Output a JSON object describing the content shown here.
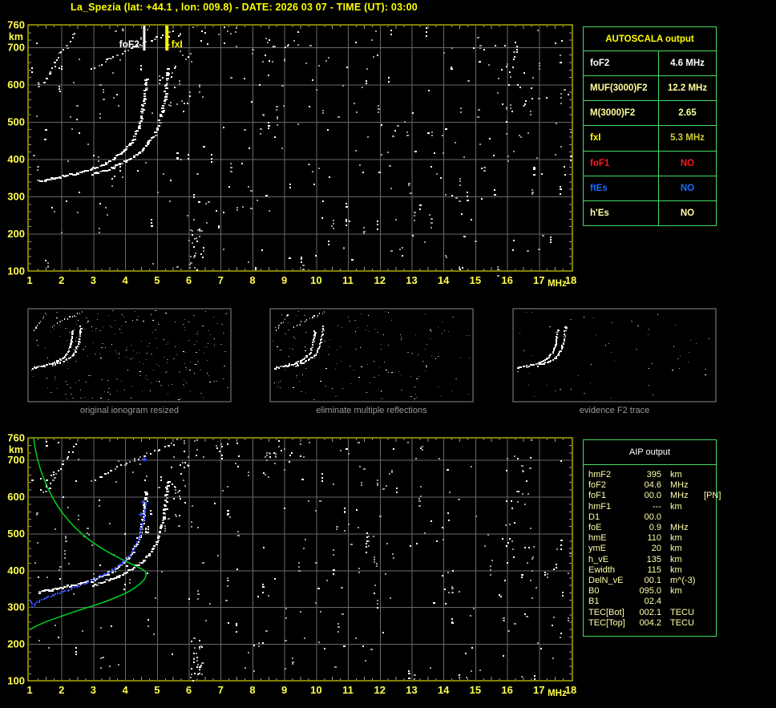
{
  "title": "La_Spezia (lat: +44.1 , lon: 009.8) - DATE: 2026 03 07 - TIME (UT): 03:00",
  "colors": {
    "background": "#000000",
    "plot_border": "#ffff00",
    "grid": "#686868",
    "tick": "#9a9a9a",
    "axis_text": "#ffff4d",
    "title_text": "#ffff00",
    "table_border": "#44dd66",
    "autoscala_title": "#ffff00",
    "panel_border": "#8a8a8a",
    "caption_text": "#9a9a9a",
    "trace_white": "#ffffff",
    "noise_gray": "#9b9b9b",
    "profile_green": "#00dd22",
    "fitted_blue": "#3a50ff",
    "aip_text": "#ffffa8",
    "aip_title": "#ffffff"
  },
  "autoscala_table": {
    "title": "AUTOSCALA output",
    "rows": [
      {
        "label": "foF2",
        "value": "4.6 MHz",
        "label_color": "#ffffff",
        "value_color": "#ffffff"
      },
      {
        "label": "MUF(3000)F2",
        "value": "12.2 MHz",
        "label_color": "#ffff99",
        "value_color": "#ffff99"
      },
      {
        "label": "M(3000)F2",
        "value": "2.65",
        "label_color": "#ffff99",
        "value_color": "#ffff99"
      },
      {
        "label": "fxI",
        "value": "5.3 MHz",
        "label_color": "#ffff00",
        "value_color": "#cdcd2e"
      },
      {
        "label": "foF1",
        "value": "NO",
        "label_color": "#ff1a1a",
        "value_color": "#ff1a1a"
      },
      {
        "label": "ftEs",
        "value": "NO",
        "label_color": "#1a6aff",
        "value_color": "#1a6aff"
      },
      {
        "label": "h'Es",
        "value": "NO",
        "label_color": "#ffffaa",
        "value_color": "#ffffaa"
      }
    ]
  },
  "aip_table": {
    "title": "AIP output",
    "rows": [
      {
        "name": "hmF2",
        "value": "395",
        "unit": "km",
        "extra": ""
      },
      {
        "name": "foF2",
        "value": "04.6",
        "unit": "MHz",
        "extra": ""
      },
      {
        "name": "foF1",
        "value": "00.0",
        "unit": "MHz",
        "extra": "[PN]"
      },
      {
        "name": "hmF1",
        "value": "---",
        "unit": "km",
        "extra": ""
      },
      {
        "name": "D1",
        "value": "00.0",
        "unit": "",
        "extra": ""
      },
      {
        "name": "foE",
        "value": "0.9",
        "unit": "MHz",
        "extra": ""
      },
      {
        "name": "hmE",
        "value": "110",
        "unit": "km",
        "extra": ""
      },
      {
        "name": "ymE",
        "value": "20",
        "unit": "km",
        "extra": ""
      },
      {
        "name": "h_vE",
        "value": "135",
        "unit": "km",
        "extra": ""
      },
      {
        "name": "Ewidth",
        "value": "115",
        "unit": "km",
        "extra": ""
      },
      {
        "name": "DelN_vE",
        "value": "00.1",
        "unit": "m^(-3)",
        "extra": ""
      },
      {
        "name": "B0",
        "value": "095.0",
        "unit": "km",
        "extra": ""
      },
      {
        "name": "B1",
        "value": "02.4",
        "unit": "",
        "extra": ""
      },
      {
        "name": "TEC[Bot]",
        "value": "002.1",
        "unit": "TECU",
        "extra": ""
      },
      {
        "name": "TEC[Top]",
        "value": "004.2",
        "unit": "TECU",
        "extra": ""
      }
    ]
  },
  "panels": [
    {
      "caption": "original ionogram resized",
      "noise_dots": 240,
      "show_multiples": true
    },
    {
      "caption": "eliminate multiple reflections",
      "noise_dots": 150,
      "show_multiples": true
    },
    {
      "caption": "evidence F2 trace",
      "noise_dots": 55,
      "show_multiples": false
    }
  ],
  "chart_data": [
    {
      "id": "top-ionogram",
      "type": "scatter",
      "title": "",
      "xlabel": "MHz",
      "ylabel": "km",
      "xlim": [
        1,
        18
      ],
      "ylim": [
        100,
        760
      ],
      "xticks": [
        1,
        2,
        3,
        4,
        5,
        6,
        7,
        8,
        9,
        10,
        11,
        12,
        13,
        14,
        15,
        16,
        17,
        18
      ],
      "yticks": [
        100,
        200,
        300,
        400,
        500,
        600,
        700,
        760
      ],
      "grid": true,
      "annotations": [
        {
          "label": "foF2",
          "freq": 4.6,
          "color": "#ffffff",
          "side": "left"
        },
        {
          "label": "fxI",
          "freq": 5.3,
          "color": "#ffff00",
          "side": "right"
        }
      ],
      "series": [
        {
          "name": "F2 ordinary echo trace",
          "points": [
            [
              1.25,
              342
            ],
            [
              1.6,
              348
            ],
            [
              2.0,
              355
            ],
            [
              2.4,
              362
            ],
            [
              2.8,
              371
            ],
            [
              3.15,
              382
            ],
            [
              3.45,
              394
            ],
            [
              3.7,
              408
            ],
            [
              3.95,
              425
            ],
            [
              4.15,
              445
            ],
            [
              4.3,
              468
            ],
            [
              4.42,
              495
            ],
            [
              4.5,
              525
            ],
            [
              4.56,
              556
            ],
            [
              4.6,
              590
            ],
            [
              4.63,
              618
            ]
          ]
        },
        {
          "name": "F2 extraordinary echo trace",
          "points": [
            [
              2.95,
              362
            ],
            [
              3.3,
              371
            ],
            [
              3.65,
              382
            ],
            [
              3.95,
              394
            ],
            [
              4.25,
              408
            ],
            [
              4.5,
              424
            ],
            [
              4.7,
              442
            ],
            [
              4.87,
              463
            ],
            [
              5.0,
              489
            ],
            [
              5.1,
              518
            ],
            [
              5.18,
              550
            ],
            [
              5.24,
              582
            ],
            [
              5.28,
              615
            ],
            [
              5.31,
              645
            ]
          ]
        },
        {
          "name": "multiple reflection streak A",
          "points": [
            [
              1.45,
              612
            ],
            [
              1.7,
              648
            ],
            [
              1.95,
              682
            ],
            [
              2.2,
              714
            ],
            [
              2.45,
              744
            ]
          ]
        },
        {
          "name": "multiple reflection streak B",
          "points": [
            [
              2.95,
              643
            ],
            [
              3.45,
              668
            ],
            [
              4.0,
              692
            ],
            [
              4.55,
              714
            ],
            [
              5.1,
              733
            ],
            [
              5.6,
              748
            ]
          ]
        }
      ],
      "noise": {
        "uniform_dots": 300,
        "clusters": [
          {
            "f": [
              6.0,
              6.45
            ],
            "alt": [
              100,
              215
            ],
            "count": 26
          },
          {
            "f": [
              5.35,
              6.05
            ],
            "alt": [
              540,
              700
            ],
            "count": 20
          },
          {
            "f": [
              14.4,
              14.7
            ],
            "alt": [
              100,
              118
            ],
            "count": 4
          },
          {
            "f": [
              15.9,
              16.8
            ],
            "alt": [
              420,
              760
            ],
            "count": 26
          },
          {
            "f": [
              8.3,
              9.6
            ],
            "alt": [
              660,
              760
            ],
            "count": 14
          },
          {
            "f": [
              5.6,
              7.6
            ],
            "alt": [
              700,
              760
            ],
            "count": 16
          }
        ]
      }
    },
    {
      "id": "bottom-ionogram",
      "type": "scatter",
      "title": "",
      "xlabel": "MHz",
      "ylabel": "km",
      "xlim": [
        1,
        18
      ],
      "ylim": [
        100,
        760
      ],
      "xticks": [
        1,
        2,
        3,
        4,
        5,
        6,
        7,
        8,
        9,
        10,
        11,
        12,
        13,
        14,
        15,
        16,
        17,
        18
      ],
      "yticks": [
        100,
        200,
        300,
        400,
        500,
        600,
        700,
        760
      ],
      "grid": true,
      "annotations": [],
      "series": [
        {
          "name": "F2 ordinary echo trace",
          "points": [
            [
              1.25,
              342
            ],
            [
              1.6,
              348
            ],
            [
              2.0,
              355
            ],
            [
              2.4,
              362
            ],
            [
              2.8,
              371
            ],
            [
              3.15,
              382
            ],
            [
              3.45,
              394
            ],
            [
              3.7,
              408
            ],
            [
              3.95,
              425
            ],
            [
              4.15,
              445
            ],
            [
              4.3,
              468
            ],
            [
              4.42,
              495
            ],
            [
              4.5,
              525
            ],
            [
              4.56,
              556
            ],
            [
              4.6,
              590
            ],
            [
              4.63,
              618
            ]
          ]
        },
        {
          "name": "F2 extraordinary echo trace",
          "points": [
            [
              2.95,
              362
            ],
            [
              3.3,
              371
            ],
            [
              3.65,
              382
            ],
            [
              3.95,
              394
            ],
            [
              4.25,
              408
            ],
            [
              4.5,
              424
            ],
            [
              4.7,
              442
            ],
            [
              4.87,
              463
            ],
            [
              5.0,
              489
            ],
            [
              5.1,
              518
            ],
            [
              5.18,
              550
            ],
            [
              5.24,
              582
            ],
            [
              5.28,
              615
            ],
            [
              5.31,
              645
            ]
          ]
        },
        {
          "name": "multiple reflection streak A",
          "points": [
            [
              1.45,
              612
            ],
            [
              1.7,
              648
            ],
            [
              1.95,
              682
            ],
            [
              2.2,
              714
            ],
            [
              2.45,
              744
            ]
          ]
        },
        {
          "name": "multiple reflection streak B",
          "points": [
            [
              2.95,
              643
            ],
            [
              3.45,
              668
            ],
            [
              4.0,
              692
            ],
            [
              4.55,
              714
            ],
            [
              5.1,
              733
            ],
            [
              5.6,
              748
            ]
          ]
        }
      ],
      "model_profile": {
        "name": "AIP electron density profile (plasma frequency vs height)",
        "color": "#00dd22",
        "points": [
          [
            1.12,
            760
          ],
          [
            1.22,
            712
          ],
          [
            1.38,
            664
          ],
          [
            1.6,
            618
          ],
          [
            1.9,
            572
          ],
          [
            2.3,
            528
          ],
          [
            2.78,
            489
          ],
          [
            3.3,
            458
          ],
          [
            3.82,
            433
          ],
          [
            4.25,
            415
          ],
          [
            4.55,
            402
          ],
          [
            4.65,
            393
          ],
          [
            4.62,
            378
          ],
          [
            4.45,
            362
          ],
          [
            4.15,
            344
          ],
          [
            3.75,
            328
          ],
          [
            3.28,
            312
          ],
          [
            2.78,
            298
          ],
          [
            2.28,
            284
          ],
          [
            1.82,
            270
          ],
          [
            1.45,
            258
          ],
          [
            1.18,
            247
          ],
          [
            1.02,
            240
          ]
        ]
      },
      "fitted_trace": {
        "name": "fitted F2 trace (restored ordinary trace)",
        "color": "#3a50ff",
        "points": [
          [
            1.0,
            320
          ],
          [
            1.06,
            305
          ],
          [
            1.15,
            312
          ],
          [
            1.35,
            322
          ],
          [
            1.6,
            331
          ],
          [
            1.9,
            340
          ],
          [
            2.2,
            349
          ],
          [
            2.55,
            360
          ],
          [
            2.9,
            372
          ],
          [
            3.2,
            384
          ],
          [
            3.5,
            398
          ],
          [
            3.75,
            413
          ],
          [
            4.0,
            431
          ],
          [
            4.2,
            452
          ],
          [
            4.35,
            476
          ],
          [
            4.46,
            503
          ],
          [
            4.54,
            533
          ],
          [
            4.6,
            563
          ],
          [
            4.63,
            588
          ]
        ],
        "plus_marks": [
          [
            4.6,
            702
          ],
          [
            4.57,
            586
          ],
          [
            4.5,
            552
          ]
        ]
      },
      "noise": {
        "uniform_dots": 300,
        "clusters": [
          {
            "f": [
              6.0,
              6.45
            ],
            "alt": [
              100,
              215
            ],
            "count": 26
          },
          {
            "f": [
              5.35,
              6.05
            ],
            "alt": [
              540,
              700
            ],
            "count": 20
          },
          {
            "f": [
              14.4,
              14.7
            ],
            "alt": [
              100,
              118
            ],
            "count": 4
          },
          {
            "f": [
              15.9,
              16.8
            ],
            "alt": [
              420,
              760
            ],
            "count": 26
          },
          {
            "f": [
              8.3,
              9.6
            ],
            "alt": [
              660,
              760
            ],
            "count": 14
          },
          {
            "f": [
              5.6,
              7.6
            ],
            "alt": [
              700,
              760
            ],
            "count": 16
          }
        ]
      }
    }
  ]
}
